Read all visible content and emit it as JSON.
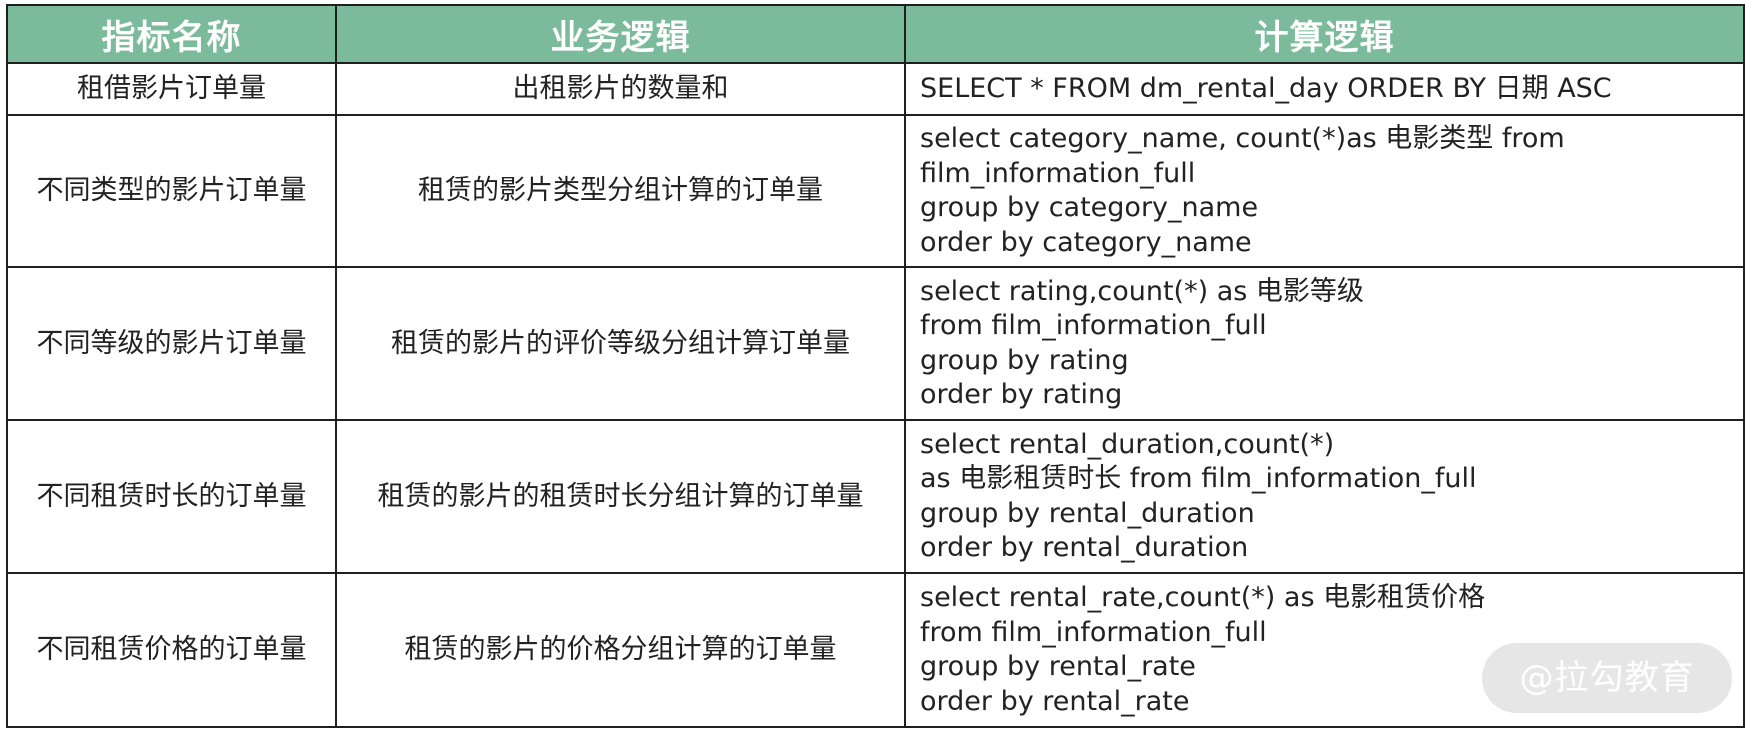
{
  "table": {
    "headers": [
      "指标名称",
      "业务逻辑",
      "计算逻辑"
    ],
    "rows": [
      {
        "name": "租借影片订单量",
        "logic": "出租影片的数量和",
        "code": [
          "SELECT * FROM dm_rental_day ORDER BY 日期 ASC"
        ]
      },
      {
        "name": "不同类型的影片订单量",
        "logic": "租赁的影片类型分组计算的订单量",
        "code": [
          "select category_name, count(*)as 电影类型 from",
          "film_information_full",
          "group by category_name",
          "order by category_name"
        ]
      },
      {
        "name": "不同等级的影片订单量",
        "logic": "租赁的影片的评价等级分组计算订单量",
        "code": [
          "select rating,count(*) as 电影等级",
          "from film_information_full",
          "group by rating",
          "order by rating"
        ]
      },
      {
        "name": "不同租赁时长的订单量",
        "logic": "租赁的影片的租赁时长分组计算的订单量",
        "code": [
          "select rental_duration,count(*)",
          "as 电影租赁时长 from film_information_full",
          "group by rental_duration",
          "order by rental_duration"
        ]
      },
      {
        "name": "不同租赁价格的订单量",
        "logic": "租赁的影片的价格分组计算的订单量",
        "code": [
          "select rental_rate,count(*) as 电影租赁价格",
          "from film_information_full",
          "group by rental_rate",
          "order by rental_rate"
        ]
      }
    ]
  },
  "watermark": "@拉勾教育",
  "colors": {
    "header_bg": "#7bbb9b",
    "header_text": "#ffffff",
    "border": "#1f1f1f"
  }
}
